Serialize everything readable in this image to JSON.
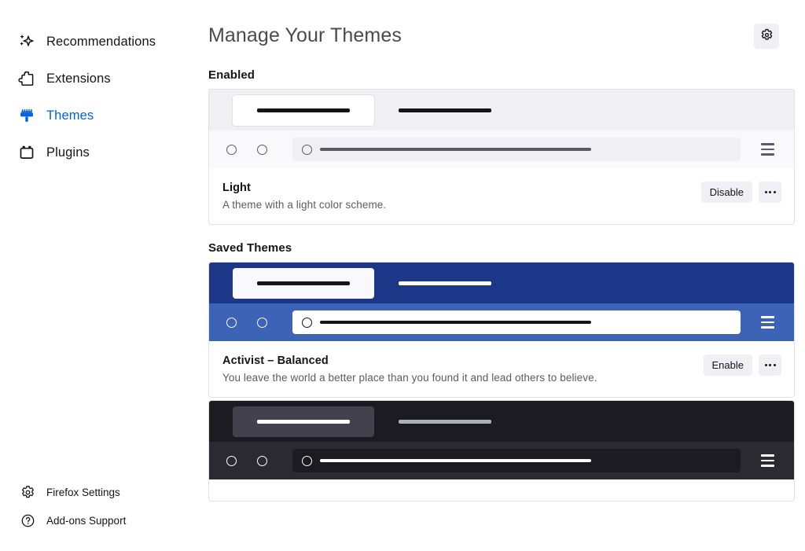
{
  "sidebar": {
    "items": [
      {
        "label": "Recommendations",
        "icon": "sparkle-icon",
        "active": false
      },
      {
        "label": "Extensions",
        "icon": "puzzle-piece-icon",
        "active": false
      },
      {
        "label": "Themes",
        "icon": "paintbrush-icon",
        "active": true
      },
      {
        "label": "Plugins",
        "icon": "plugin-brick-icon",
        "active": false
      }
    ],
    "footer_items": [
      {
        "label": "Firefox Settings",
        "icon": "gear-icon"
      },
      {
        "label": "Add-ons Support",
        "icon": "question-circle-icon"
      }
    ]
  },
  "header": {
    "title": "Manage Your Themes",
    "settings_icon": "gear-icon"
  },
  "sections": [
    {
      "title": "Enabled"
    },
    {
      "title": "Saved Themes"
    }
  ],
  "themes": {
    "enabled": {
      "name": "Light",
      "description": "A theme with a light color scheme.",
      "action_label": "Disable",
      "more_label": "More options",
      "colors": {
        "tabbar": "#f0f0f4",
        "active_tab": "#ffffff",
        "active_tab_line": "#15141a",
        "inactive_tab_line": "#15141a",
        "navbar": "#f9f9fb",
        "nav_icon": "#5b5b66",
        "urlbar": "#f0f0f4",
        "url_line": "#5b5b66",
        "hamburger": "#5b5b66"
      }
    },
    "saved": {
      "name": "Activist – Balanced",
      "description": "You leave the world a better place than you found it and lead others to believe.",
      "action_label": "Enable",
      "more_label": "More options",
      "colors": {
        "tabbar": "#1c3787",
        "active_tab": "#f9f9fd",
        "active_tab_line": "#15141a",
        "inactive_tab_line": "#ffffff",
        "navbar": "#3c63b5",
        "nav_icon": "#ffffff",
        "urlbar": "#ffffff",
        "url_line": "#15141a",
        "hamburger": "#ffffff"
      }
    },
    "saved_partial": {
      "name": "",
      "colors": {
        "tabbar": "#1c1b22",
        "active_tab": "#42414d",
        "active_tab_line": "#ffffff",
        "inactive_tab_line": "#b1b1bb",
        "navbar": "#2b2a33",
        "nav_icon": "#ffffff",
        "urlbar": "#1c1b22",
        "url_line": "#ffffff",
        "hamburger": "#ffffff"
      }
    }
  },
  "accent": {
    "brand_blue": "#0060df",
    "text": "#15141a",
    "muted_text": "#5b5b66",
    "button_bg": "#f0f0f4",
    "card_border": "#e0e0e6"
  }
}
